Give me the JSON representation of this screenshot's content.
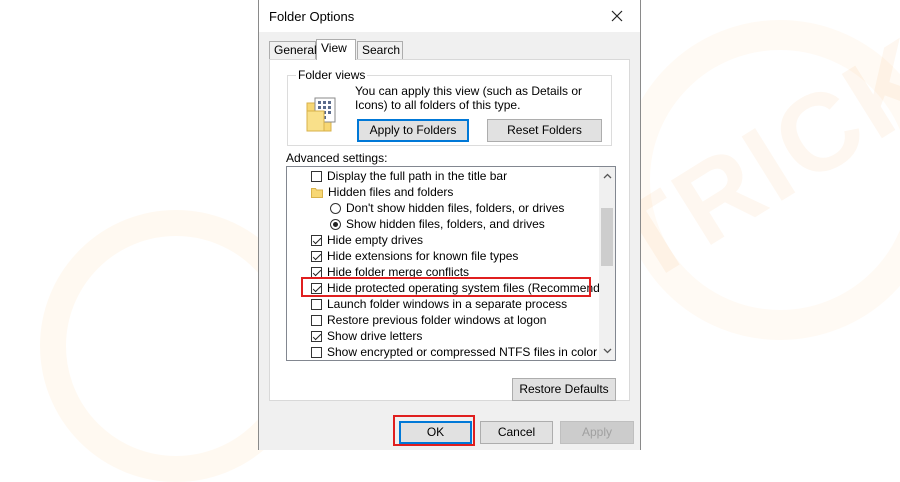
{
  "watermark": {
    "text": "EVERTRICKS"
  },
  "window": {
    "title": "Folder Options",
    "close_icon": "close-icon"
  },
  "tabs": [
    {
      "label": "General",
      "active": false
    },
    {
      "label": "View",
      "active": true
    },
    {
      "label": "Search",
      "active": false
    }
  ],
  "folder_views": {
    "title": "Folder views",
    "description": "You can apply this view (such as Details or Icons) to all folders of this type.",
    "apply_button": "Apply to Folders",
    "reset_button": "Reset Folders"
  },
  "advanced": {
    "label": "Advanced settings:",
    "items": [
      {
        "type": "checkbox",
        "checked": false,
        "label": "Display the full path in the title bar"
      },
      {
        "type": "folder",
        "label": "Hidden files and folders"
      },
      {
        "type": "radio",
        "checked": false,
        "label": "Don't show hidden files, folders, or drives"
      },
      {
        "type": "radio",
        "checked": true,
        "label": "Show hidden files, folders, and drives"
      },
      {
        "type": "checkbox",
        "checked": true,
        "label": "Hide empty drives"
      },
      {
        "type": "checkbox",
        "checked": true,
        "label": "Hide extensions for known file types"
      },
      {
        "type": "checkbox",
        "checked": true,
        "label": "Hide folder merge conflicts"
      },
      {
        "type": "checkbox",
        "checked": true,
        "label": "Hide protected operating system files (Recommended)"
      },
      {
        "type": "checkbox",
        "checked": false,
        "label": "Launch folder windows in a separate process"
      },
      {
        "type": "checkbox",
        "checked": false,
        "label": "Restore previous folder windows at logon"
      },
      {
        "type": "checkbox",
        "checked": true,
        "label": "Show drive letters"
      },
      {
        "type": "checkbox",
        "checked": false,
        "label": "Show encrypted or compressed NTFS files in color"
      }
    ],
    "restore_button": "Restore Defaults"
  },
  "footer": {
    "ok": "OK",
    "cancel": "Cancel",
    "apply": "Apply"
  },
  "colors": {
    "highlight": "#e01f1f",
    "focus": "#0078d7"
  }
}
